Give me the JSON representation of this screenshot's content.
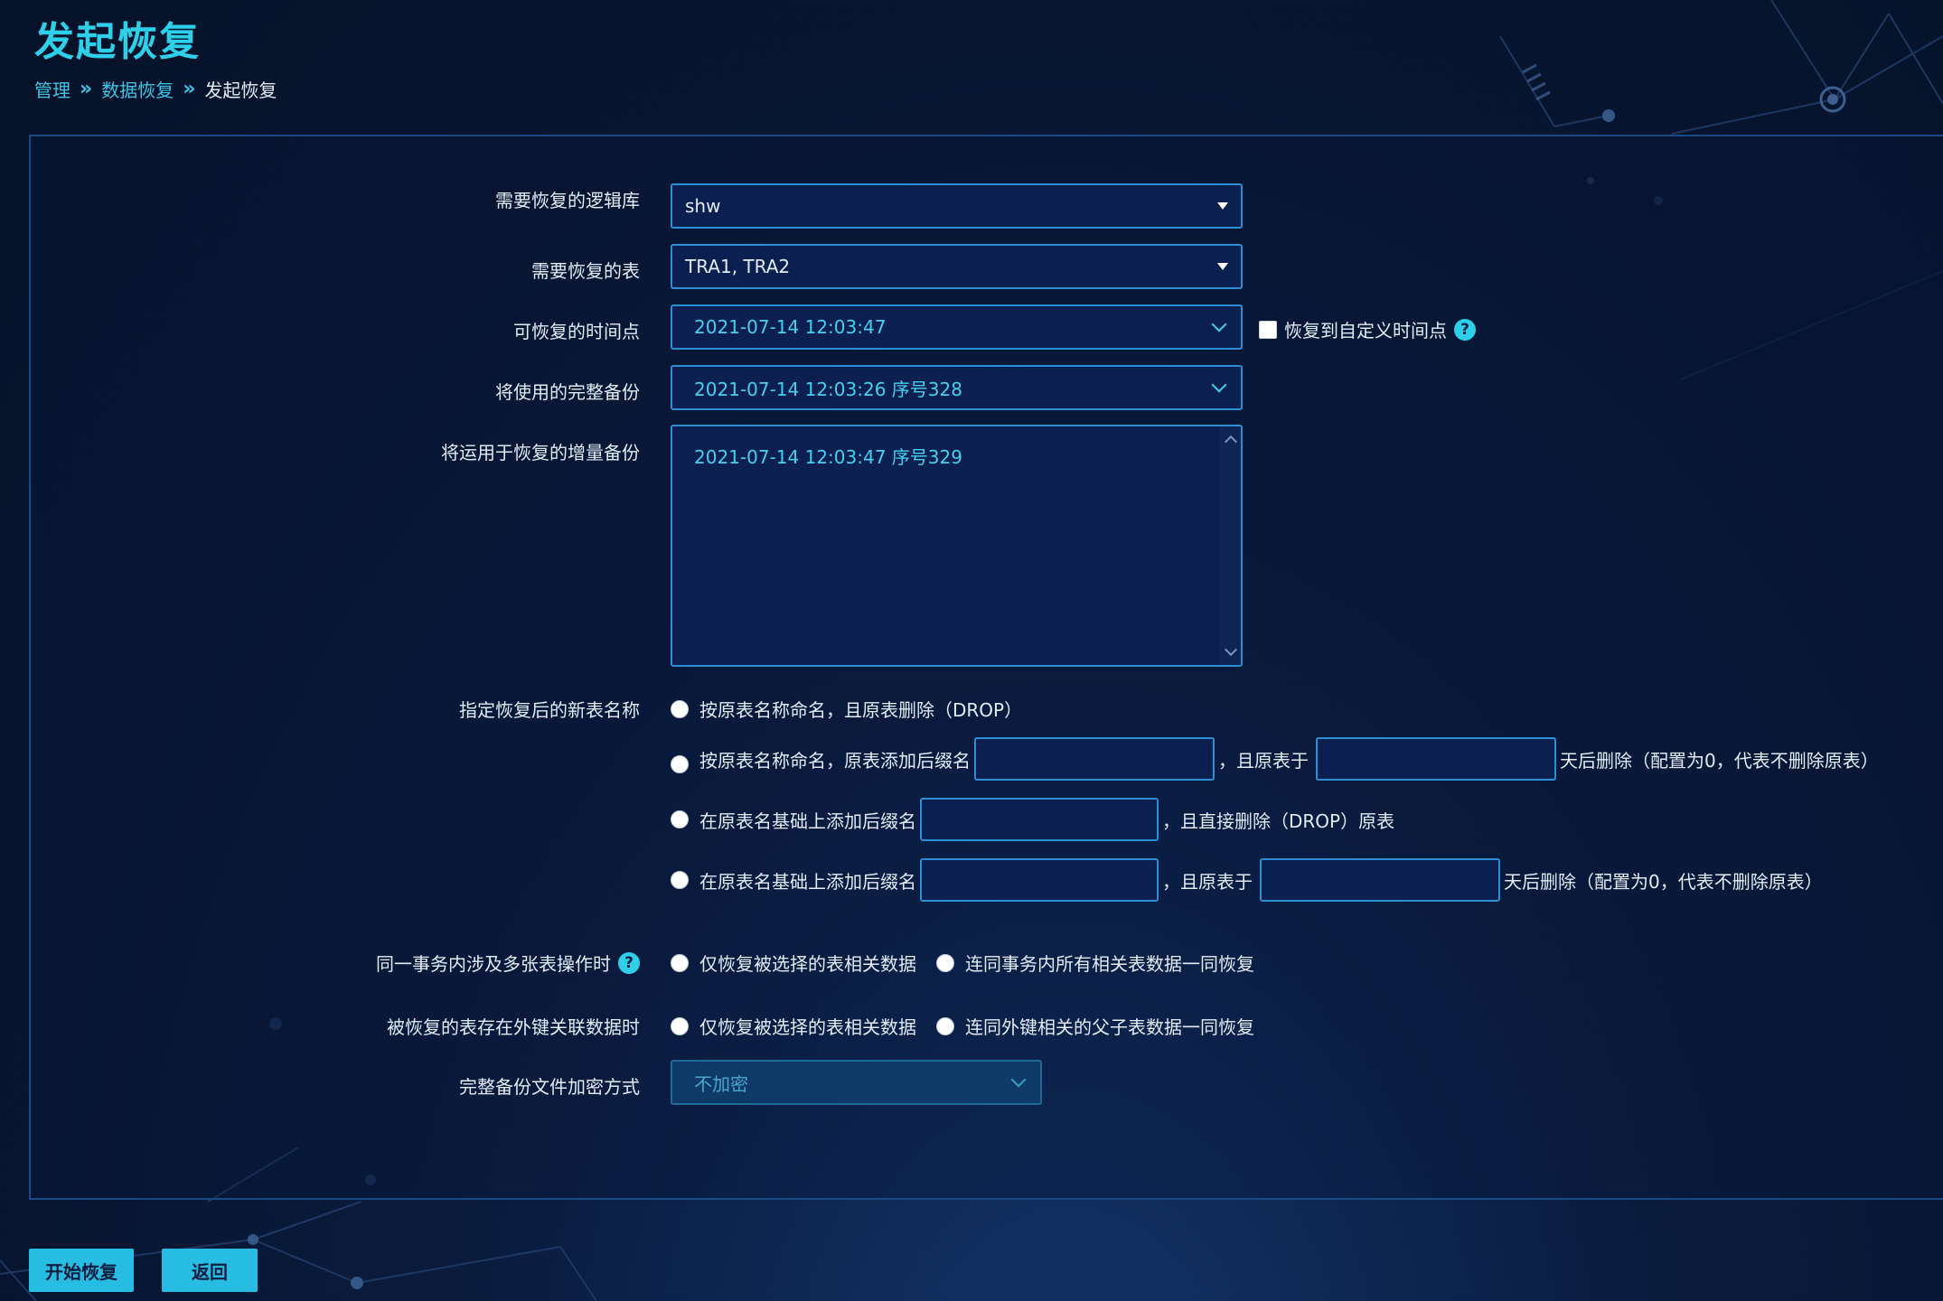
{
  "page": {
    "title": "发起恢复"
  },
  "breadcrumb": {
    "items": [
      "管理",
      "数据恢复"
    ],
    "current": "发起恢复"
  },
  "form": {
    "logical_db": {
      "label": "需要恢复的逻辑库",
      "value": "shw"
    },
    "tables": {
      "label": "需要恢复的表",
      "value": "TRA1, TRA2"
    },
    "time_point": {
      "label": "可恢复的时间点",
      "value": "2021-07-14 12:03:47",
      "custom_label": "恢复到自定义时间点",
      "custom_checked": false
    },
    "full_backup": {
      "label": "将使用的完整备份",
      "value": "2021-07-14 12:03:26 序号328"
    },
    "incremental_backup": {
      "label": "将运用于恢复的增量备份",
      "items": [
        "2021-07-14 12:03:47 序号329"
      ]
    },
    "new_table_name": {
      "label": "指定恢复后的新表名称",
      "options": [
        {
          "text": "按原表名称命名，且原表删除（DROP）"
        },
        {
          "text": "按原表名称命名，原表添加后缀名",
          "mid": "，且原表于",
          "end": "天后删除（配置为0，代表不删除原表）",
          "suffix": "",
          "days": ""
        },
        {
          "text": "在原表名基础上添加后缀名",
          "mid": "，且直接删除（DROP）原表",
          "suffix": ""
        },
        {
          "text": "在原表名基础上添加后缀名",
          "mid": "，且原表于",
          "end": "天后删除（配置为0，代表不删除原表）",
          "suffix": "",
          "days": ""
        }
      ]
    },
    "multi_table_tx": {
      "label": "同一事务内涉及多张表操作时",
      "options": [
        "仅恢复被选择的表相关数据",
        "连同事务内所有相关表数据一同恢复"
      ]
    },
    "foreign_key": {
      "label": "被恢复的表存在外键关联数据时",
      "options": [
        "仅恢复被选择的表相关数据",
        "连同外键相关的父子表数据一同恢复"
      ]
    },
    "encryption": {
      "label": "完整备份文件加密方式",
      "value": "不加密"
    }
  },
  "buttons": {
    "start": "开始恢复",
    "back": "返回"
  }
}
